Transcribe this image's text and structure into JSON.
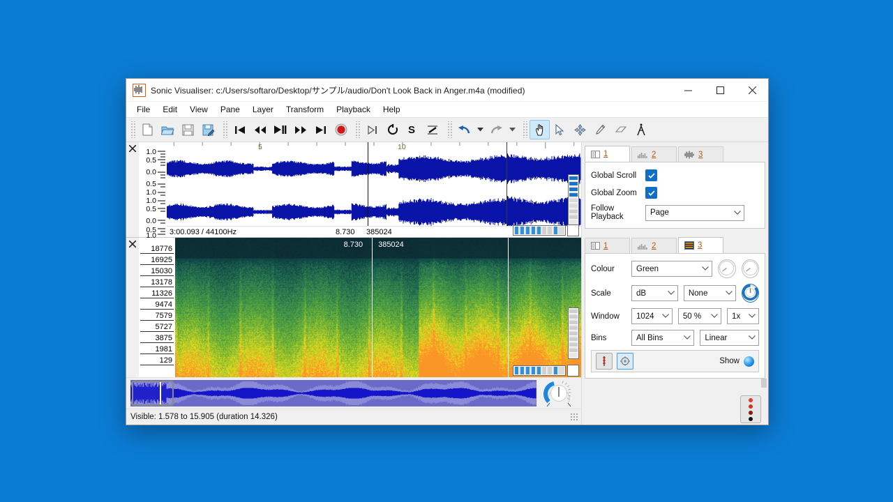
{
  "window": {
    "title": "Sonic Visualiser: c:/Users/softaro/Desktop/サンプル/audio/Don't Look Back in Anger.m4a (modified)",
    "app_icon": "waveform-icon",
    "minimize": "–",
    "maximize": "□",
    "close": "✕"
  },
  "menu": [
    {
      "label": "File"
    },
    {
      "label": "Edit"
    },
    {
      "label": "View"
    },
    {
      "label": "Pane"
    },
    {
      "label": "Layer"
    },
    {
      "label": "Transform"
    },
    {
      "label": "Playback"
    },
    {
      "label": "Help"
    }
  ],
  "toolbar": {
    "file_group": [
      "new-session-icon",
      "open-session-icon",
      "save-session-icon",
      "save-session-as-icon"
    ],
    "transport_group": [
      "rewind-to-start-icon",
      "rewind-icon",
      "play-pause-icon",
      "fast-forward-icon",
      "forward-to-end-icon",
      "record-icon"
    ],
    "playback_group": [
      "play-selection-icon",
      "loop-icon",
      "solo-icon",
      "align-icon"
    ],
    "edit_group": [
      "undo-icon",
      "undo-dropdown-icon",
      "redo-icon",
      "redo-dropdown-icon"
    ],
    "tool_group": [
      "navigate-tool-icon",
      "select-tool-icon",
      "edit-tool-icon",
      "draw-tool-icon",
      "erase-tool-icon",
      "measure-tool-icon"
    ],
    "active_tool": "navigate-tool-icon"
  },
  "wave_pane": {
    "close_icon": "close-pane-icon",
    "channel_scale": [
      "1.0",
      "0.5",
      "0.0",
      "0.5",
      "1.0"
    ],
    "ruler_ticks": [
      "5",
      "10"
    ],
    "info": "3:00.093 / 44100Hz",
    "playhead_time": "8.730",
    "playhead_frame": "385024",
    "waveform_color": "#0a13a8"
  },
  "spectrogram_pane": {
    "close_icon": "close-pane-icon",
    "frequency_labels": [
      "18776",
      "16925",
      "15030",
      "13178",
      "11326",
      "9474",
      "7579",
      "5727",
      "3875",
      "1981",
      "129"
    ],
    "playhead_time": "8.730",
    "playhead_frame": "385024",
    "colour_low": "#0c2a31",
    "colour_mid": "#3f9e5c",
    "colour_high": "#ffe01a"
  },
  "overview": {
    "viewport_label": "overview-viewport-box",
    "bg_color": "#6a6ac8",
    "selection_color": "#1414c8"
  },
  "volume": {
    "knob_name": "playback-volume-knob",
    "arc_color": "#1c86e0"
  },
  "level_meter": {
    "name": "level-meter-button",
    "dots": [
      "#e03c2a",
      "#d03225",
      "#8c1a12",
      "#141414"
    ]
  },
  "panel_top": {
    "tabs": [
      {
        "label": "1",
        "icon": "panes-icon",
        "active": true
      },
      {
        "label": "2",
        "icon": "waveform-bars-icon",
        "active": false
      },
      {
        "label": "3",
        "icon": "waveform-wave-icon",
        "active": false
      }
    ],
    "rows": [
      {
        "label": "Global Scroll",
        "type": "checkbox",
        "checked": true
      },
      {
        "label": "Global Zoom",
        "type": "checkbox",
        "checked": true
      },
      {
        "label": "Follow Playback",
        "type": "select",
        "value": "Page"
      }
    ]
  },
  "panel_layer": {
    "tabs": [
      {
        "label": "1",
        "icon": "panes-icon",
        "active": false
      },
      {
        "label": "2",
        "icon": "waveform-bars-icon",
        "active": false
      },
      {
        "label": "3",
        "icon": "spectrogram-icon",
        "active": true
      }
    ],
    "colour": {
      "label": "Colour",
      "value": "Green",
      "knob1": "gain-knob",
      "knob2": "threshold-knob"
    },
    "scale": {
      "label": "Scale",
      "value": "dB",
      "normalize": "None",
      "knob": "colour-rotate-knob"
    },
    "window": {
      "label": "Window",
      "size": "1024",
      "overlap": "50 %",
      "zoom": "1x"
    },
    "bins": {
      "label": "Bins",
      "value": "All Bins",
      "scale": "Linear"
    },
    "show": {
      "label": "Show",
      "vertical_scale_button": "vertical-scale-icon",
      "peak_button": "peak-frequencies-icon",
      "led_on": true
    }
  },
  "statusbar": {
    "text": "Visible: 1.578 to 15.905 (duration 14.326)"
  }
}
